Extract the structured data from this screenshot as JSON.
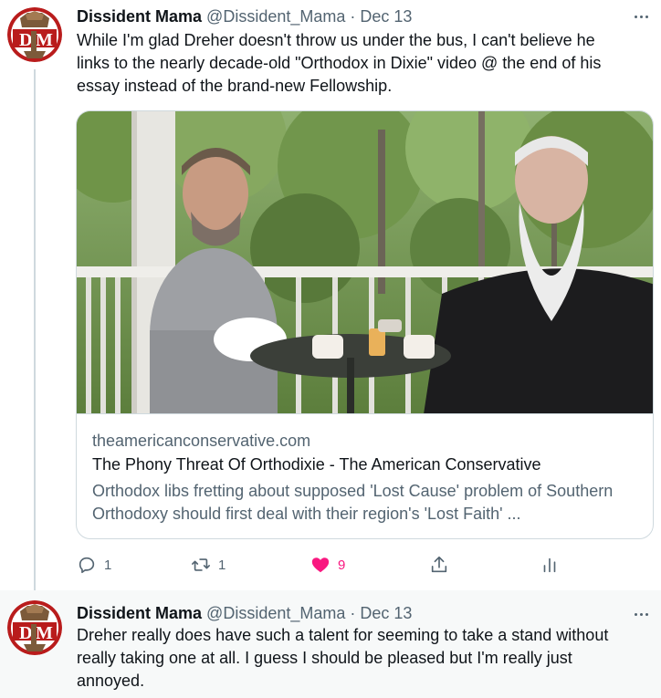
{
  "tweets": [
    {
      "author": {
        "name": "Dissident Mama",
        "handle": "@Dissident_Mama",
        "avatar_initials": "DM"
      },
      "separator": "·",
      "date": "Dec 13",
      "text": "While I'm glad Dreher doesn't throw us under the bus, I can't believe he\nlinks to the nearly decade-old \"Orthodox in Dixie\" video @ the end of his\nessay instead of the brand-new Fellowship.",
      "card": {
        "domain": "theamericanconservative.com",
        "title": "The Phony Threat Of Orthodixie - The American Conservative",
        "description": "Orthodox libs fretting about supposed 'Lost Cause' problem of Southern Orthodoxy should first deal with their region's 'Lost Faith' ..."
      },
      "actions": {
        "reply": {
          "icon": "reply-icon",
          "count": "1"
        },
        "retweet": {
          "icon": "retweet-icon",
          "count": "1"
        },
        "like": {
          "icon": "heart-filled-icon",
          "count": "9",
          "color": "#f91880"
        },
        "share": {
          "icon": "share-icon"
        },
        "analytics": {
          "icon": "analytics-icon"
        }
      }
    },
    {
      "author": {
        "name": "Dissident Mama",
        "handle": "@Dissident_Mama",
        "avatar_initials": "DM"
      },
      "separator": "·",
      "date": "Dec 13",
      "text": "Dreher really does have such a talent for seeming to take a stand without\nreally taking one at all. I guess I should be pleased but I'm really just\nannoyed."
    }
  ],
  "colors": {
    "primary_text": "#0f1419",
    "secondary_text": "#536471",
    "border": "#cfd9de",
    "like": "#f91880",
    "highlight_bg": "#f7f9f9"
  }
}
